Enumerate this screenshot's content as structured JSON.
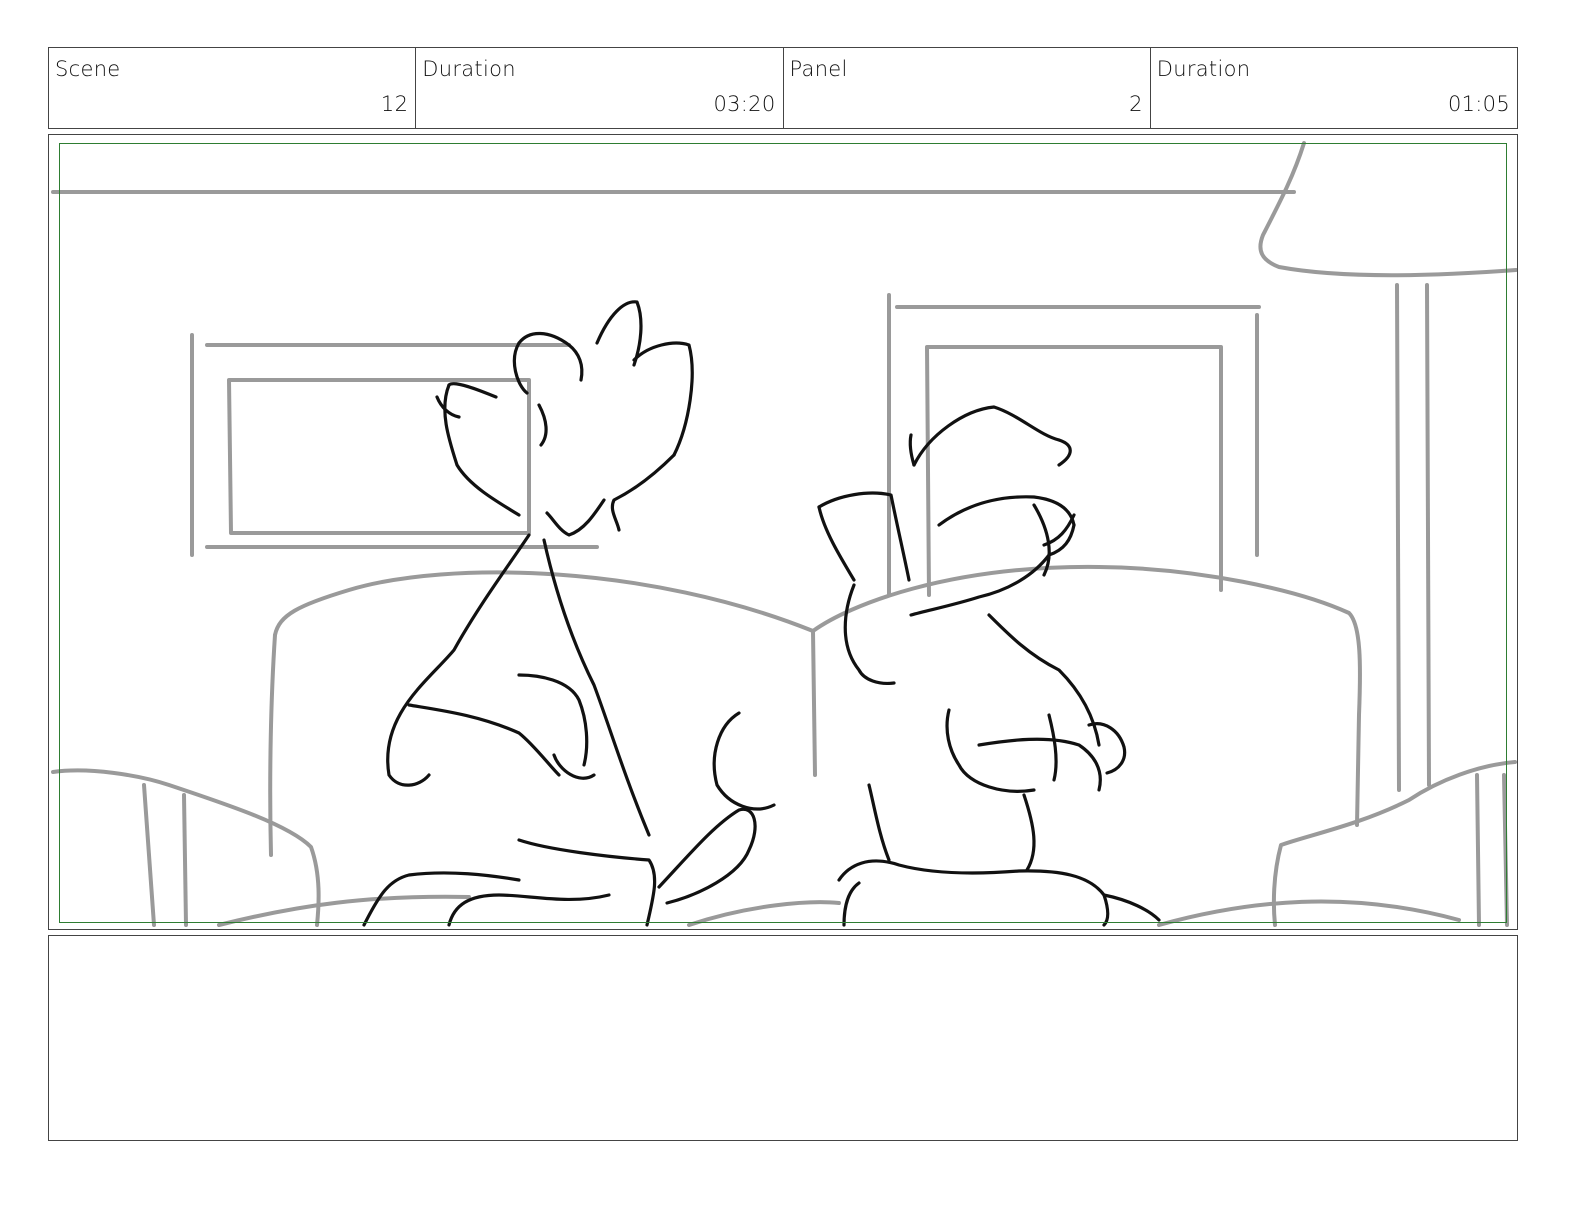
{
  "header": {
    "scene_label": "Scene",
    "scene_value": "12",
    "scene_duration_label": "Duration",
    "scene_duration_value": "03:20",
    "panel_label": "Panel",
    "panel_value": "2",
    "panel_duration_label": "Duration",
    "panel_duration_value": "01:05"
  },
  "colors": {
    "safe_frame": "#2e7d32",
    "background_sketch": "#9a9a9a",
    "character_ink": "#111111"
  },
  "notes": {
    "text": ""
  }
}
